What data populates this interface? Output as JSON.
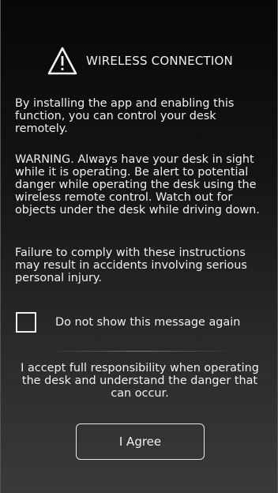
{
  "dialog": {
    "title": "WIRELESS CONNECTION",
    "title_icon": "warning-triangle-icon",
    "paragraphs": [
      "By installing the app and enabling this function, you can control your desk remotely.",
      "WARNING. Always have your desk in sight while it is operating. Be alert to potential danger while operating the desk using the wireless remote control. Watch out for objects under the desk while driving down.",
      "Failure to comply with these instructions may result in accidents involving serious personal injury."
    ],
    "checkbox": {
      "label": "Do not show this message again",
      "checked": false
    },
    "acceptance_text": "I accept full responsibility when operating the desk and understand the danger that can occur.",
    "agree_button": "I Agree"
  }
}
